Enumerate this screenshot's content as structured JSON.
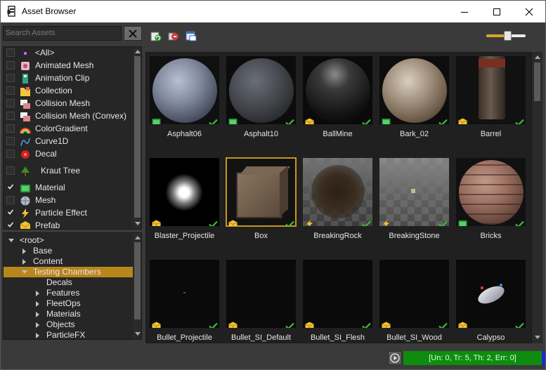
{
  "window": {
    "title": "Asset Browser",
    "minimize_icon": "minimize-icon",
    "maximize_icon": "maximize-icon",
    "close_icon": "close-icon"
  },
  "search": {
    "placeholder": "Search Assets",
    "value": "",
    "clear_icon": "x-icon"
  },
  "asset_types": [
    {
      "label": "<All>",
      "checked": false,
      "icon": "all-icon"
    },
    {
      "label": "Animated Mesh",
      "checked": false,
      "icon": "animated-mesh-icon"
    },
    {
      "label": "Animation Clip",
      "checked": false,
      "icon": "animation-clip-icon"
    },
    {
      "label": "Collection",
      "checked": false,
      "icon": "collection-icon"
    },
    {
      "label": "Collision Mesh",
      "checked": false,
      "icon": "collision-mesh-icon"
    },
    {
      "label": "Collision Mesh (Convex)",
      "checked": false,
      "icon": "collision-mesh-convex-icon"
    },
    {
      "label": "ColorGradient",
      "checked": false,
      "icon": "color-gradient-icon"
    },
    {
      "label": "Curve1D",
      "checked": false,
      "icon": "curve-icon"
    },
    {
      "label": "Decal",
      "checked": false,
      "icon": "decal-icon"
    },
    {
      "label": "Kraut Tree",
      "checked": false,
      "icon": "tree-icon"
    },
    {
      "label": "Material",
      "checked": true,
      "icon": "material-icon"
    },
    {
      "label": "Mesh",
      "checked": false,
      "icon": "mesh-icon"
    },
    {
      "label": "Particle Effect",
      "checked": true,
      "icon": "particle-effect-icon"
    },
    {
      "label": "Prefab",
      "checked": true,
      "icon": "prefab-icon"
    }
  ],
  "tree": [
    {
      "label": "<root>",
      "depth": 0,
      "expanded": true,
      "has_children": true,
      "selected": false
    },
    {
      "label": "Base",
      "depth": 1,
      "expanded": false,
      "has_children": true,
      "selected": false
    },
    {
      "label": "Content",
      "depth": 1,
      "expanded": false,
      "has_children": true,
      "selected": false
    },
    {
      "label": "Testing Chambers",
      "depth": 1,
      "expanded": true,
      "has_children": true,
      "selected": true
    },
    {
      "label": "Decals",
      "depth": 2,
      "expanded": false,
      "has_children": false,
      "selected": false
    },
    {
      "label": "Features",
      "depth": 2,
      "expanded": false,
      "has_children": true,
      "selected": false
    },
    {
      "label": "FleetOps",
      "depth": 2,
      "expanded": false,
      "has_children": true,
      "selected": false
    },
    {
      "label": "Materials",
      "depth": 2,
      "expanded": false,
      "has_children": true,
      "selected": false
    },
    {
      "label": "Objects",
      "depth": 2,
      "expanded": false,
      "has_children": true,
      "selected": false
    },
    {
      "label": "ParticleFX",
      "depth": 2,
      "expanded": false,
      "has_children": true,
      "selected": false
    }
  ],
  "toolbar": {
    "icons": [
      "refresh-icon",
      "import-icon",
      "window-icon"
    ],
    "zoom_slider": 0.55
  },
  "assets": [
    {
      "name": "Asphalt06",
      "type": "material",
      "status": "ok"
    },
    {
      "name": "Asphalt10",
      "type": "material",
      "status": "ok"
    },
    {
      "name": "BallMine",
      "type": "prefab",
      "status": "ok"
    },
    {
      "name": "Bark_02",
      "type": "material",
      "status": "ok"
    },
    {
      "name": "Barrel",
      "type": "prefab",
      "status": "ok"
    },
    {
      "name": "Blaster_Projectile",
      "type": "prefab",
      "status": "ok"
    },
    {
      "name": "Box",
      "type": "prefab",
      "status": "ok",
      "selected": true
    },
    {
      "name": "BreakingRock",
      "type": "particle",
      "status": "ok"
    },
    {
      "name": "BreakingStone",
      "type": "particle",
      "status": "ok"
    },
    {
      "name": "Bricks",
      "type": "material",
      "status": "ok"
    },
    {
      "name": "Bullet_Projectile",
      "type": "prefab",
      "status": "ok"
    },
    {
      "name": "Bullet_SI_Default",
      "type": "prefab",
      "status": "ok"
    },
    {
      "name": "Bullet_SI_Flesh",
      "type": "prefab",
      "status": "ok"
    },
    {
      "name": "Bullet_SI_Wood",
      "type": "prefab",
      "status": "ok"
    },
    {
      "name": "Calypso",
      "type": "prefab",
      "status": "ok"
    }
  ],
  "status": {
    "text": "[Un: 0, Tr: 5, Th: 2, Err: 0]",
    "play_icon": "play-icon",
    "color": "#0e8c0e"
  }
}
